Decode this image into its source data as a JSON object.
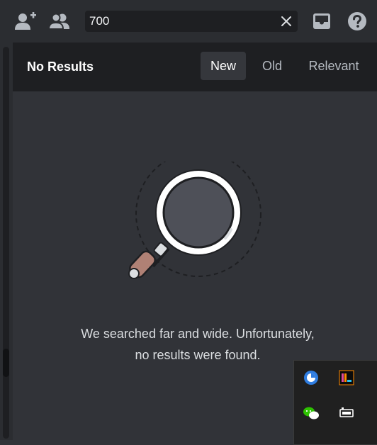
{
  "toolbar": {
    "add_friend_icon": "add-friend-icon",
    "member_list_icon": "member-list-icon",
    "inbox_icon": "inbox-icon",
    "help_icon": "help-icon"
  },
  "search": {
    "value": "700",
    "clear_icon": "close-icon"
  },
  "results_header": {
    "title": "No Results",
    "sort_tabs": [
      {
        "label": "New",
        "active": true
      },
      {
        "label": "Old",
        "active": false
      },
      {
        "label": "Relevant",
        "active": false
      }
    ]
  },
  "empty_state": {
    "icon": "magnifying-glass-icon",
    "line1": "We searched far and wide. Unfortunately,",
    "line2": "no results were found."
  },
  "system_tray": {
    "icons": [
      "browser-icon",
      "ide-icon",
      "wechat-icon",
      "device-icon"
    ]
  },
  "colors": {
    "background": "#313338",
    "header": "#1e1f22",
    "topbar": "#2b2d31",
    "accent": "#b08175"
  }
}
